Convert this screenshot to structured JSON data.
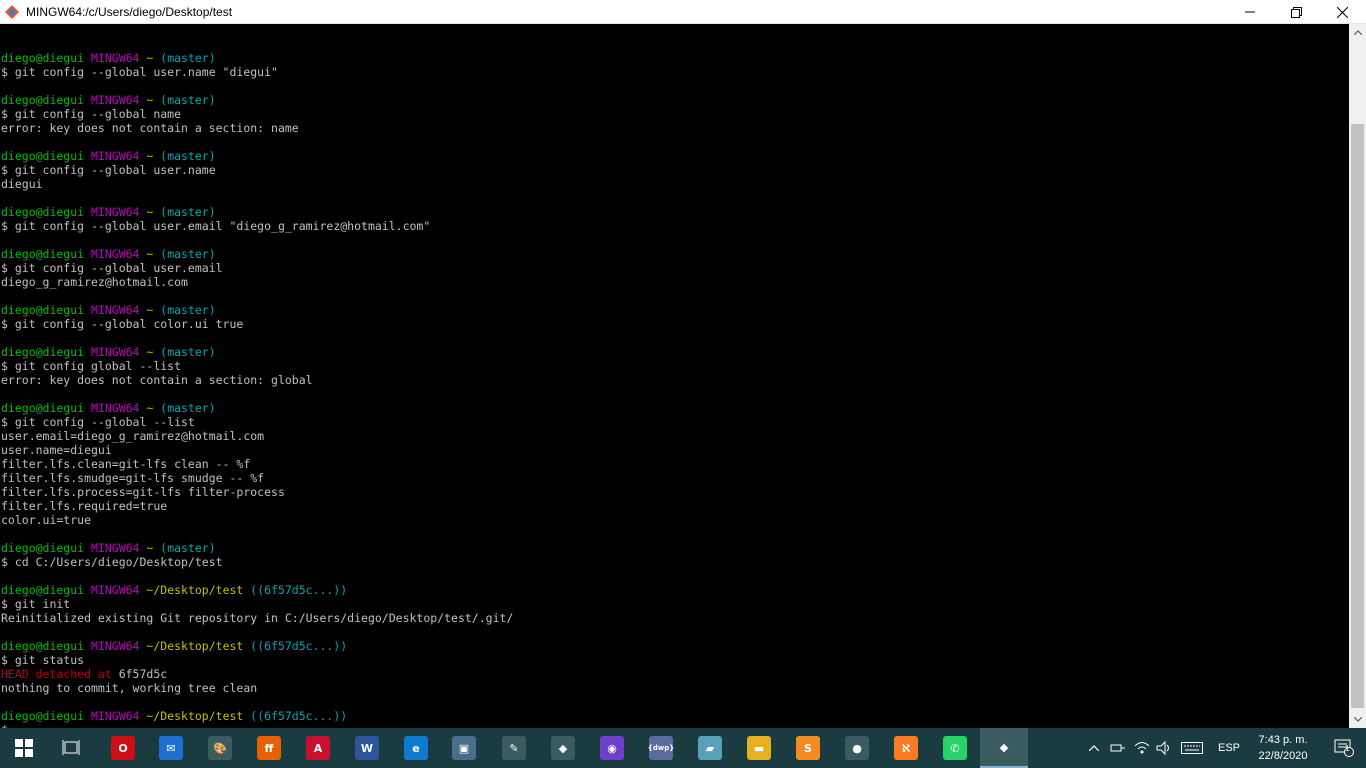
{
  "window": {
    "title": "MINGW64:/c/Users/diego/Desktop/test"
  },
  "colors": {
    "user": "#00c000",
    "host": "#c000c0",
    "path": "#c0c000",
    "branch": "#00a6b2",
    "error": "#c00000",
    "text": "#c0c0c0",
    "taskbar": "#1a3b3f"
  },
  "terminal": {
    "lines": [
      [],
      [
        {
          "t": "diego@diegui ",
          "c": "green"
        },
        {
          "t": "MINGW64 ",
          "c": "magenta"
        },
        {
          "t": "~ ",
          "c": "yellow"
        },
        {
          "t": "(master)",
          "c": "cyan"
        }
      ],
      [
        {
          "t": "$ git config --global user.name \"diegui\"",
          "c": "white"
        }
      ],
      [],
      [
        {
          "t": "diego@diegui ",
          "c": "green"
        },
        {
          "t": "MINGW64 ",
          "c": "magenta"
        },
        {
          "t": "~ ",
          "c": "yellow"
        },
        {
          "t": "(master)",
          "c": "cyan"
        }
      ],
      [
        {
          "t": "$ git config --global name",
          "c": "white"
        }
      ],
      [
        {
          "t": "error: key does not contain a section: name",
          "c": "white"
        }
      ],
      [],
      [
        {
          "t": "diego@diegui ",
          "c": "green"
        },
        {
          "t": "MINGW64 ",
          "c": "magenta"
        },
        {
          "t": "~ ",
          "c": "yellow"
        },
        {
          "t": "(master)",
          "c": "cyan"
        }
      ],
      [
        {
          "t": "$ git config --global user.name",
          "c": "white"
        }
      ],
      [
        {
          "t": "diegui",
          "c": "white"
        }
      ],
      [],
      [
        {
          "t": "diego@diegui ",
          "c": "green"
        },
        {
          "t": "MINGW64 ",
          "c": "magenta"
        },
        {
          "t": "~ ",
          "c": "yellow"
        },
        {
          "t": "(master)",
          "c": "cyan"
        }
      ],
      [
        {
          "t": "$ git config --global user.email \"diego_g_ramirez@hotmail.com\"",
          "c": "white"
        }
      ],
      [],
      [
        {
          "t": "diego@diegui ",
          "c": "green"
        },
        {
          "t": "MINGW64 ",
          "c": "magenta"
        },
        {
          "t": "~ ",
          "c": "yellow"
        },
        {
          "t": "(master)",
          "c": "cyan"
        }
      ],
      [
        {
          "t": "$ git config --global user.email",
          "c": "white"
        }
      ],
      [
        {
          "t": "diego_g_ramirez@hotmail.com",
          "c": "white"
        }
      ],
      [],
      [
        {
          "t": "diego@diegui ",
          "c": "green"
        },
        {
          "t": "MINGW64 ",
          "c": "magenta"
        },
        {
          "t": "~ ",
          "c": "yellow"
        },
        {
          "t": "(master)",
          "c": "cyan"
        }
      ],
      [
        {
          "t": "$ git config --global color.ui true",
          "c": "white"
        }
      ],
      [],
      [
        {
          "t": "diego@diegui ",
          "c": "green"
        },
        {
          "t": "MINGW64 ",
          "c": "magenta"
        },
        {
          "t": "~ ",
          "c": "yellow"
        },
        {
          "t": "(master)",
          "c": "cyan"
        }
      ],
      [
        {
          "t": "$ git config global --list",
          "c": "white"
        }
      ],
      [
        {
          "t": "error: key does not contain a section: global",
          "c": "white"
        }
      ],
      [],
      [
        {
          "t": "diego@diegui ",
          "c": "green"
        },
        {
          "t": "MINGW64 ",
          "c": "magenta"
        },
        {
          "t": "~ ",
          "c": "yellow"
        },
        {
          "t": "(master)",
          "c": "cyan"
        }
      ],
      [
        {
          "t": "$ git config --global --list",
          "c": "white"
        }
      ],
      [
        {
          "t": "user.email=diego_g_ramirez@hotmail.com",
          "c": "white"
        }
      ],
      [
        {
          "t": "user.name=diegui",
          "c": "white"
        }
      ],
      [
        {
          "t": "filter.lfs.clean=git-lfs clean -- %f",
          "c": "white"
        }
      ],
      [
        {
          "t": "filter.lfs.smudge=git-lfs smudge -- %f",
          "c": "white"
        }
      ],
      [
        {
          "t": "filter.lfs.process=git-lfs filter-process",
          "c": "white"
        }
      ],
      [
        {
          "t": "filter.lfs.required=true",
          "c": "white"
        }
      ],
      [
        {
          "t": "color.ui=true",
          "c": "white"
        }
      ],
      [],
      [
        {
          "t": "diego@diegui ",
          "c": "green"
        },
        {
          "t": "MINGW64 ",
          "c": "magenta"
        },
        {
          "t": "~ ",
          "c": "yellow"
        },
        {
          "t": "(master)",
          "c": "cyan"
        }
      ],
      [
        {
          "t": "$ cd C:/Users/diego/Desktop/test",
          "c": "white"
        }
      ],
      [],
      [
        {
          "t": "diego@diegui ",
          "c": "green"
        },
        {
          "t": "MINGW64 ",
          "c": "magenta"
        },
        {
          "t": "~/Desktop/test ",
          "c": "yellow"
        },
        {
          "t": "((6f57d5c...))",
          "c": "cyan"
        }
      ],
      [
        {
          "t": "$ git init",
          "c": "white"
        }
      ],
      [
        {
          "t": "Reinitialized existing Git repository in C:/Users/diego/Desktop/test/.git/",
          "c": "white"
        }
      ],
      [],
      [
        {
          "t": "diego@diegui ",
          "c": "green"
        },
        {
          "t": "MINGW64 ",
          "c": "magenta"
        },
        {
          "t": "~/Desktop/test ",
          "c": "yellow"
        },
        {
          "t": "((6f57d5c...))",
          "c": "cyan"
        }
      ],
      [
        {
          "t": "$ git status",
          "c": "white"
        }
      ],
      [
        {
          "t": "HEAD detached at ",
          "c": "red"
        },
        {
          "t": "6f57d5c",
          "c": "white"
        }
      ],
      [
        {
          "t": "nothing to commit, working tree clean",
          "c": "white"
        }
      ],
      [],
      [
        {
          "t": "diego@diegui ",
          "c": "green"
        },
        {
          "t": "MINGW64 ",
          "c": "magenta"
        },
        {
          "t": "~/Desktop/test ",
          "c": "yellow"
        },
        {
          "t": "((6f57d5c...))",
          "c": "cyan"
        }
      ],
      [
        {
          "t": "$",
          "c": "white"
        }
      ]
    ]
  },
  "taskbar": {
    "apps": [
      {
        "name": "start",
        "icon": "windows-icon"
      },
      {
        "name": "task-view",
        "icon": "task-view-icon"
      },
      {
        "name": "opera",
        "icon": "opera-icon",
        "label": "O",
        "color": "#cc0f16"
      },
      {
        "name": "mail",
        "icon": "mail-icon",
        "label": "✉",
        "color": "#1f6fd1"
      },
      {
        "name": "paint",
        "icon": "paint-icon",
        "label": "🎨",
        "color": "#3a5c60"
      },
      {
        "name": "firefox",
        "icon": "firefox-icon",
        "label": "ff",
        "color": "#e66000"
      },
      {
        "name": "acrobat",
        "icon": "acrobat-icon",
        "label": "A",
        "color": "#c8102e"
      },
      {
        "name": "word",
        "icon": "word-icon",
        "label": "W",
        "color": "#2b579a"
      },
      {
        "name": "edge",
        "icon": "edge-icon",
        "label": "e",
        "color": "#0f7bcf"
      },
      {
        "name": "screen-tool",
        "icon": "screen-tool-icon",
        "label": "▣",
        "color": "#4a6e8a"
      },
      {
        "name": "pencil-app",
        "icon": "pencil-icon",
        "label": "✎",
        "color": "#3a5c60"
      },
      {
        "name": "git-gui",
        "icon": "git-icon",
        "label": "◆",
        "color": "#3a5c60"
      },
      {
        "name": "github-desktop",
        "icon": "github-icon",
        "label": "◉",
        "color": "#6e40c9"
      },
      {
        "name": "dwp",
        "icon": "dwp-icon",
        "label": "{dwp}",
        "color": "#5a6c9e"
      },
      {
        "name": "viewer",
        "icon": "viewer-icon",
        "label": "▰",
        "color": "#5aa0b8"
      },
      {
        "name": "explorer",
        "icon": "folder-icon",
        "label": "▬",
        "color": "#e8b020"
      },
      {
        "name": "sublime",
        "icon": "sublime-icon",
        "label": "S",
        "color": "#f28b22"
      },
      {
        "name": "chrome",
        "icon": "chrome-icon",
        "label": "●",
        "color": "#3a5c60"
      },
      {
        "name": "xampp",
        "icon": "xampp-icon",
        "label": "ℵ",
        "color": "#fb7a24"
      },
      {
        "name": "whatsapp",
        "icon": "whatsapp-icon",
        "label": "✆",
        "color": "#25d366"
      },
      {
        "name": "git-bash",
        "icon": "git-bash-icon",
        "label": "◆",
        "color": "#3a5c60",
        "active": true
      }
    ],
    "tray": {
      "language": "ESP",
      "time": "7:43 p. m.",
      "date": "22/8/2020",
      "notifications": "1"
    }
  }
}
